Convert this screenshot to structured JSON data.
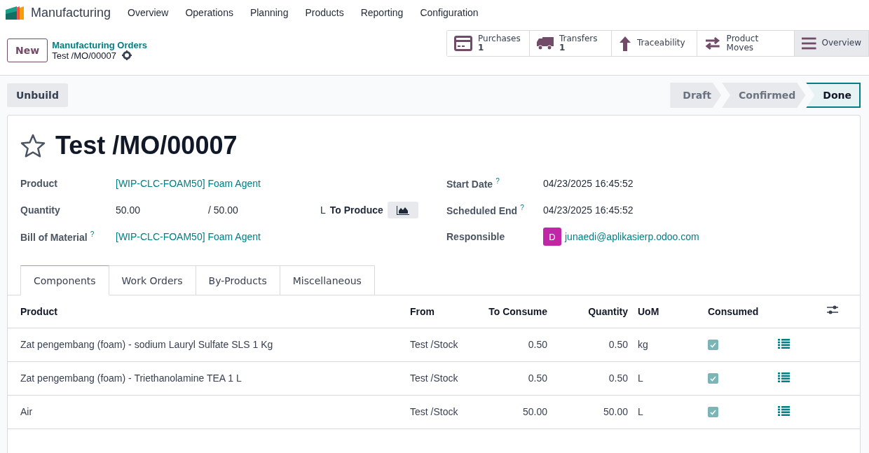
{
  "app": {
    "name": "Manufacturing"
  },
  "menu": [
    "Overview",
    "Operations",
    "Planning",
    "Products",
    "Reporting",
    "Configuration"
  ],
  "control_panel": {
    "new_button": "New",
    "breadcrumb": "Manufacturing Orders",
    "record": "Test /MO/00007"
  },
  "smart_buttons": [
    {
      "kind": "card",
      "label": "Purchases",
      "count": "1",
      "highlighted": false
    },
    {
      "kind": "truck",
      "label": "Transfers",
      "count": "1",
      "highlighted": false
    },
    {
      "kind": "arrow",
      "label": "Traceability",
      "highlighted": false
    },
    {
      "kind": "swap",
      "label": "Product Moves",
      "highlighted": false
    },
    {
      "kind": "list",
      "label": "Overview",
      "highlighted": true
    }
  ],
  "action_button": "Unbuild",
  "stages": [
    {
      "label": "Draft",
      "selected": false
    },
    {
      "label": "Confirmed",
      "selected": false
    },
    {
      "label": "Done",
      "selected": true
    }
  ],
  "title": {
    "text": "Test /MO/00007",
    "starred": false
  },
  "left_fields": [
    {
      "kind": "link",
      "label": "Product",
      "value": "[WIP-CLC-FOAM50] Foam Agent"
    },
    {
      "kind": "quantity",
      "label": "Quantity",
      "value": "50.00",
      "total": "/ 50.00",
      "uom": "L",
      "suffix": "To Produce"
    },
    {
      "kind": "link",
      "label": "Bill of Material",
      "help": "?",
      "value": "[WIP-CLC-FOAM50] Foam Agent"
    }
  ],
  "right_fields": [
    {
      "kind": "text",
      "label": "Start Date",
      "help": "?",
      "value": "04/23/2025 16:45:52"
    },
    {
      "kind": "text",
      "label": "Scheduled End",
      "help": "?",
      "value": "04/23/2025 16:45:52"
    },
    {
      "kind": "user",
      "label": "Responsible",
      "initial": "D",
      "value": "junaedi@aplikasierp.odoo.com"
    }
  ],
  "tabs": [
    {
      "label": "Components",
      "selected": true
    },
    {
      "label": "Work Orders",
      "selected": false
    },
    {
      "label": "By-Products",
      "selected": false
    },
    {
      "label": "Miscellaneous",
      "selected": false
    }
  ],
  "table": {
    "columns": [
      "Product",
      "From",
      "To Consume",
      "Quantity",
      "UoM",
      "Consumed"
    ],
    "rows": [
      {
        "product": "Zat pengembang (foam) - sodium Lauryl Sulfate SLS 1 Kg",
        "from": "Test /Stock",
        "to_consume": "0.50",
        "quantity": "0.50",
        "uom": "kg",
        "consumed": true
      },
      {
        "product": "Zat pengembang (foam) - Triethanolamine TEA 1 L",
        "from": "Test /Stock",
        "to_consume": "0.50",
        "quantity": "0.50",
        "uom": "L",
        "consumed": true
      },
      {
        "product": "Air",
        "from": "Test /Stock",
        "to_consume": "50.00",
        "quantity": "50.00",
        "uom": "L",
        "consumed": true
      }
    ]
  }
}
